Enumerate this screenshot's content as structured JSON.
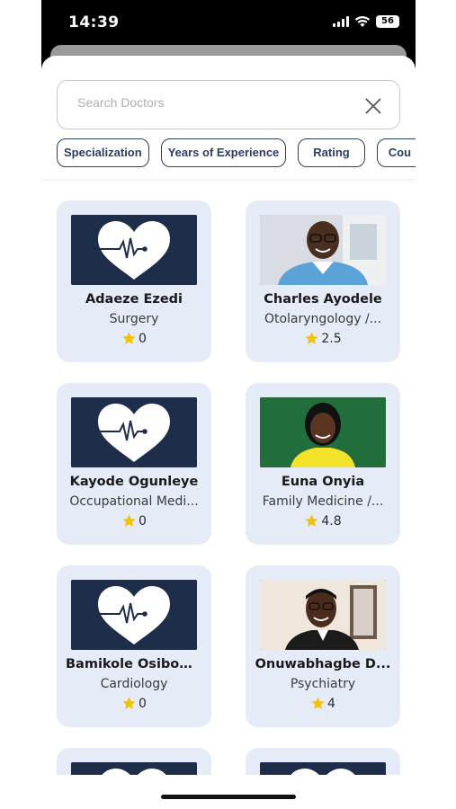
{
  "status_bar": {
    "time": "14:39",
    "battery": "56"
  },
  "search": {
    "placeholder": "Search Doctors",
    "value": ""
  },
  "filters": [
    "Specialization",
    "Years of Experience",
    "Rating",
    "Cou"
  ],
  "doctors": [
    {
      "name": "Adaeze Ezedi",
      "specialization": "Surgery",
      "rating": "0",
      "image": "heart-pulse-placeholder"
    },
    {
      "name": "Charles Ayodele",
      "specialization": "Otolaryngology /...",
      "rating": "2.5",
      "image": "photo"
    },
    {
      "name": "Kayode Ogunleye",
      "specialization": "Occupational Medi...",
      "rating": "0",
      "image": "heart-pulse-placeholder"
    },
    {
      "name": "Euna Onyia",
      "specialization": "Family Medicine /...",
      "rating": "4.8",
      "image": "photo"
    },
    {
      "name": "Bamikole Osibow...",
      "specialization": "Cardiology",
      "rating": "0",
      "image": "heart-pulse-placeholder"
    },
    {
      "name": "Onuwabhagbe D...",
      "specialization": "Psychiatry",
      "rating": "4",
      "image": "photo"
    }
  ],
  "colors": {
    "card_bg": "#e5ecf8",
    "navy": "#1e2d4a",
    "chip_border": "#2c3e63",
    "star": "#f2c200"
  }
}
